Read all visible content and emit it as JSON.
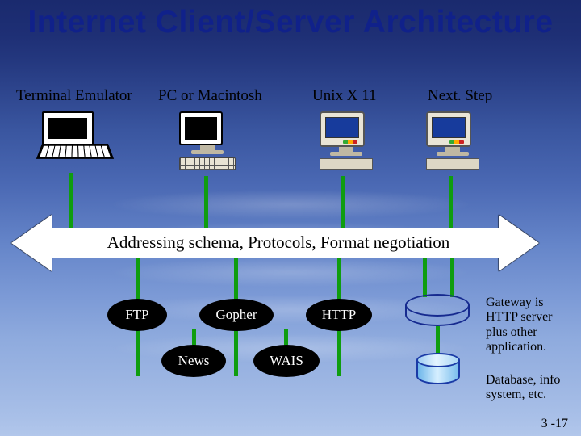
{
  "title": "Internet Client/Server Architecture",
  "clients": {
    "c1": "Terminal Emulator",
    "c2": "PC or Macintosh",
    "c3": "Unix X 11",
    "c4": "Next. Step"
  },
  "middle_layer": "Addressing schema, Protocols, Format negotiation",
  "protocols": {
    "ftp": "FTP",
    "gopher": "Gopher",
    "http": "HTTP",
    "news": "News",
    "wais": "WAIS"
  },
  "notes": {
    "gateway": "Gateway is HTTP server plus other application.",
    "database": "Database, info system, etc."
  },
  "slide_number": "3 -17",
  "colors": {
    "title": "#10218a",
    "connector": "#0f9d0f"
  }
}
